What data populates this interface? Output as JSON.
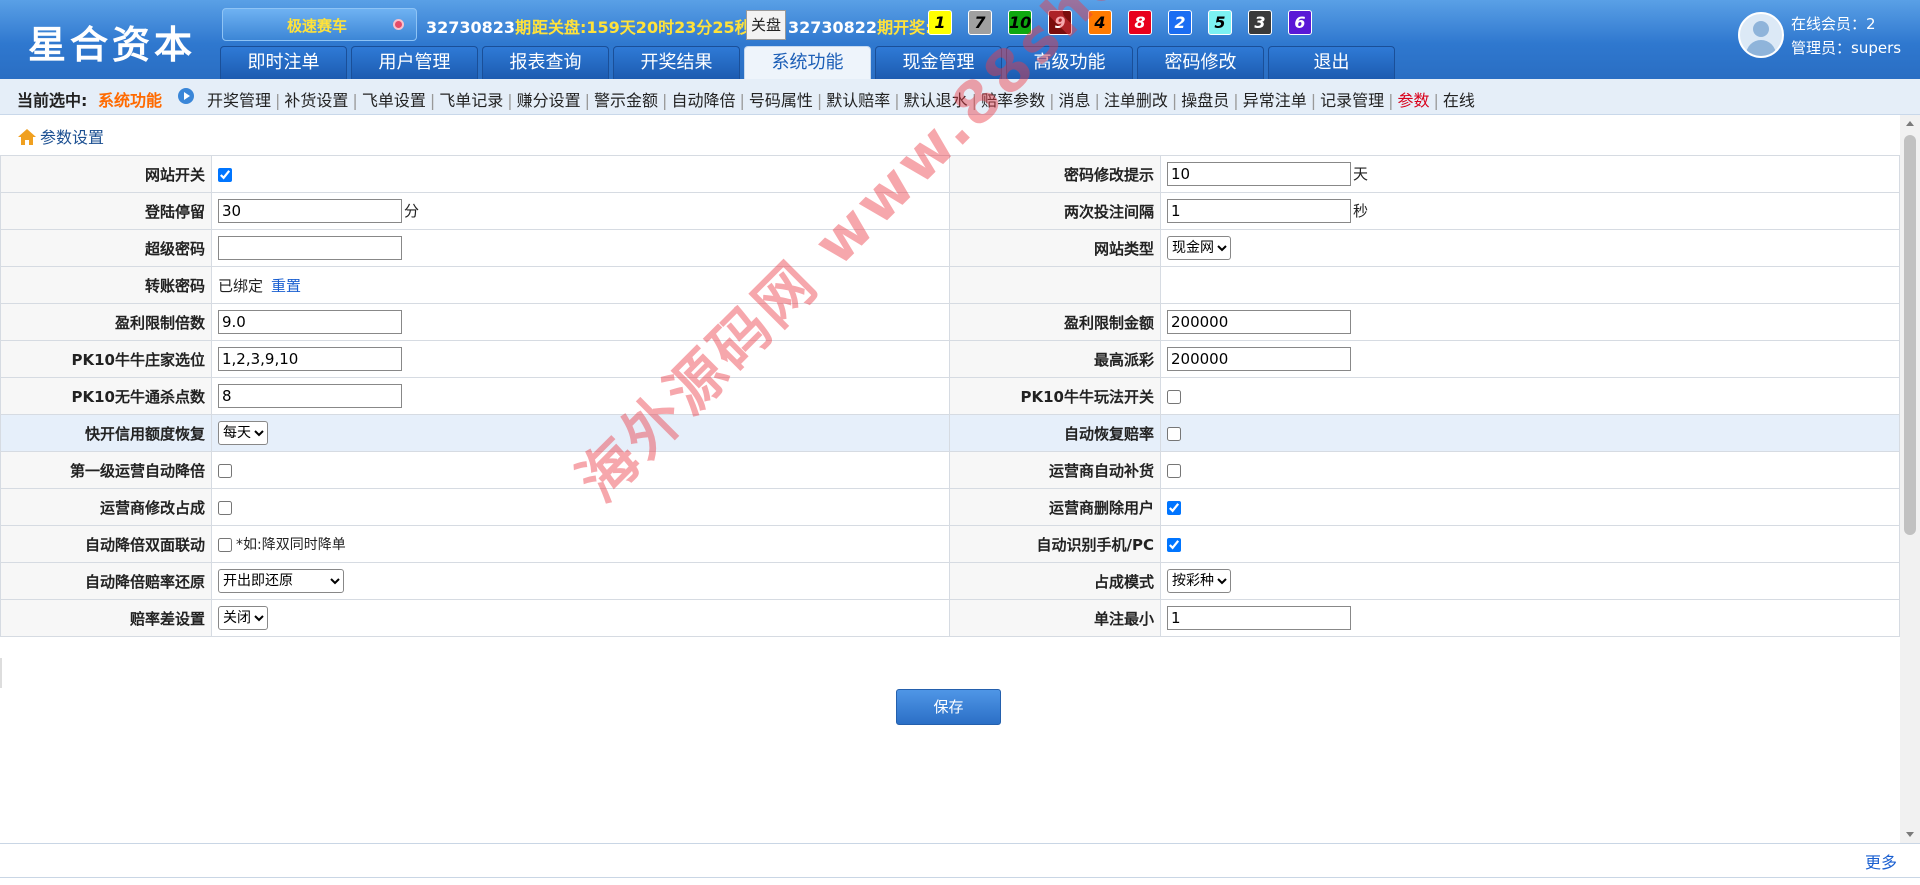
{
  "header": {
    "logo": "星合资本",
    "game": "极速赛车",
    "current_period": "32730823",
    "period_suffix": "期",
    "countdown_label": "距关盘:",
    "countdown": "159天20时23分25秒",
    "close_label": "关盘",
    "last_period": "32730822",
    "last_period_suffix": "期开奖:",
    "balls": [
      {
        "n": "1",
        "bg": "#ffff00",
        "fg": "#000000"
      },
      {
        "n": "7",
        "bg": "#a0a0a0",
        "fg": "#000000"
      },
      {
        "n": "10",
        "bg": "#0fa80f",
        "fg": "#000000"
      },
      {
        "n": "9",
        "bg": "#7a0d0d",
        "fg": "#ffffff"
      },
      {
        "n": "4",
        "bg": "#ff7a00",
        "fg": "#000000"
      },
      {
        "n": "8",
        "bg": "#e8001c",
        "fg": "#ffffff"
      },
      {
        "n": "2",
        "bg": "#1b6df2",
        "fg": "#ffffff"
      },
      {
        "n": "5",
        "bg": "#7cf2f2",
        "fg": "#000000"
      },
      {
        "n": "3",
        "bg": "#3a3a3a",
        "fg": "#ffffff"
      },
      {
        "n": "6",
        "bg": "#5a18d6",
        "fg": "#ffffff"
      }
    ],
    "online_members": "在线会员：2",
    "admin": "管理员：supers"
  },
  "nav": {
    "tabs": [
      "即时注单",
      "用户管理",
      "报表查询",
      "开奖结果",
      "系统功能",
      "现金管理",
      "高级功能",
      "密码修改",
      "退出"
    ],
    "active": "系统功能"
  },
  "subnav": {
    "current_label": "当前选中:",
    "current_value": "系统功能",
    "links": [
      "开奖管理",
      "补货设置",
      "飞单设置",
      "飞单记录",
      "赚分设置",
      "警示金额",
      "自动降倍",
      "号码属性",
      "默认赔率",
      "默认退水",
      "赔率参数",
      "消息",
      "注单删改",
      "操盘员",
      "异常注单",
      "记录管理",
      "参数",
      "在线"
    ],
    "highlight": "参数"
  },
  "breadcrumb": "参数设置",
  "form": {
    "website_switch": "网站开关",
    "website_switch_checked": true,
    "pwd_hint": "密码修改提示",
    "pwd_hint_value": "10",
    "pwd_hint_unit": "天",
    "login_stay": "登陆停留",
    "login_stay_value": "30",
    "login_stay_unit": "分",
    "bet_interval": "两次投注间隔",
    "bet_interval_value": "1",
    "bet_interval_unit": "秒",
    "super_pwd": "超级密码",
    "super_pwd_value": "",
    "site_type": "网站类型",
    "site_type_value": "现金网",
    "transfer_pwd": "转账密码",
    "transfer_pwd_status": "已绑定",
    "transfer_pwd_reset": "重置",
    "profit_multiple": "盈利限制倍数",
    "profit_multiple_value": "9.0",
    "profit_amount": "盈利限制金额",
    "profit_amount_value": "200000",
    "pk10_banker": "PK10牛牛庄家选位",
    "pk10_banker_value": "1,2,3,9,10",
    "max_payout": "最高派彩",
    "max_payout_value": "200000",
    "pk10_nobull": "PK10无牛通杀点数",
    "pk10_nobull_value": "8",
    "pk10_switch": "PK10牛牛玩法开关",
    "pk10_switch_checked": false,
    "credit_recover": "快开信用额度恢复",
    "credit_recover_value": "每天",
    "auto_odds_recover": "自动恢复赔率",
    "auto_odds_recover_checked": false,
    "lvl1_auto_reduce": "第一级运营自动降倍",
    "lvl1_auto_reduce_checked": false,
    "op_auto_supply": "运营商自动补货",
    "op_auto_supply_checked": false,
    "op_edit_share": "运营商修改占成",
    "op_edit_share_checked": false,
    "op_delete_user": "运营商删除用户",
    "op_delete_user_checked": true,
    "reduce_linkage": "自动降倍双面联动",
    "reduce_linkage_checked": false,
    "reduce_linkage_note": "*如:降双同时降单",
    "auto_detect": "自动识别手机/PC",
    "auto_detect_checked": true,
    "reduce_restore": "自动降倍赔率还原",
    "reduce_restore_value": "开出即还原",
    "share_mode": "占成模式",
    "share_mode_value": "按彩种",
    "odds_diff": "赔率差设置",
    "odds_diff_value": "关闭",
    "min_bet": "单注最小",
    "min_bet_value": "1"
  },
  "save_label": "保存",
  "footer_more": "更多",
  "watermark": "海外源码网 www.88shops.top"
}
